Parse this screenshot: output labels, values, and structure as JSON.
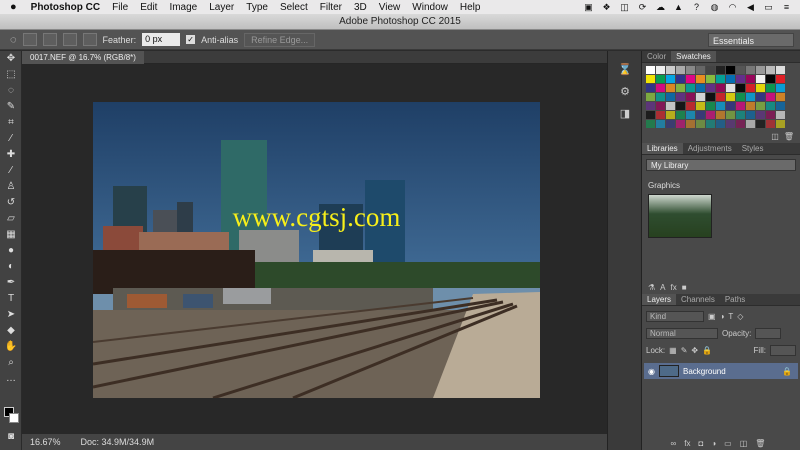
{
  "menubar": {
    "app": "Photoshop CC",
    "items": [
      "File",
      "Edit",
      "Image",
      "Layer",
      "Type",
      "Select",
      "Filter",
      "3D",
      "View",
      "Window",
      "Help"
    ],
    "status_icons": [
      "shield-icon",
      "dropbox-icon",
      "box-icon",
      "sync-icon",
      "cloud-icon",
      "alert-icon",
      "help-icon",
      "creative-cloud-icon",
      "wifi-icon",
      "volume-icon",
      "battery-icon",
      "menu-list-icon"
    ]
  },
  "title": "Adobe Photoshop CC 2015",
  "options": {
    "feather_label": "Feather:",
    "feather_value": "0 px",
    "antialias_label": "Anti-alias",
    "refine_label": "Refine Edge...",
    "workspace": "Essentials"
  },
  "document": {
    "tab": "0017.NEF @ 16.7% (RGB/8*)",
    "watermark": "www.cgtsj.com",
    "zoom": "16.67%",
    "doc_size": "Doc: 34.9M/34.9M"
  },
  "panels": {
    "color_tabs": [
      "Color",
      "Swatches"
    ],
    "libraries_tabs": [
      "Libraries",
      "Adjustments",
      "Styles"
    ],
    "library_selected": "My Library",
    "graphics_label": "Graphics",
    "layers_tabs": [
      "Layers",
      "Channels",
      "Paths"
    ],
    "kind_label": "Kind",
    "blend_mode": "Normal",
    "opacity_label": "Opacity:",
    "lock_label": "Lock:",
    "fill_label": "Fill:",
    "layer_name": "Background"
  }
}
